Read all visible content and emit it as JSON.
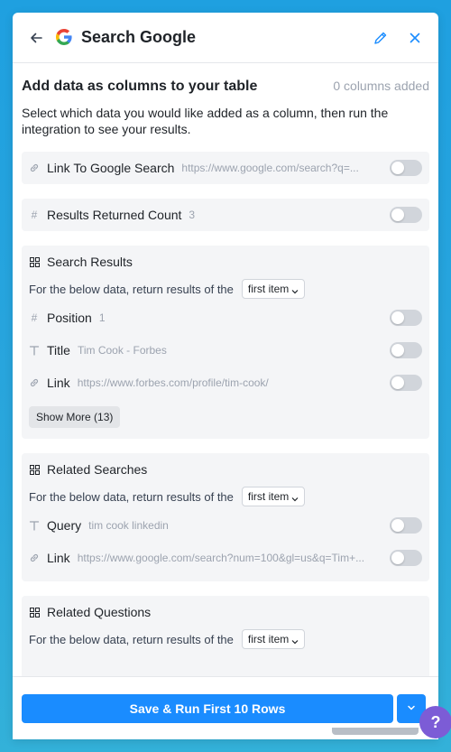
{
  "header": {
    "title": "Search Google"
  },
  "intro": {
    "heading": "Add data as columns to your table",
    "columns_added": "0 columns added",
    "description": "Select which data you would like added as a column, then run the integration to see your results."
  },
  "fields": [
    {
      "icon": "link-icon",
      "label": "Link To Google Search",
      "sample": "https://www.google.com/search?q=..."
    },
    {
      "icon": "hash-icon",
      "label": "Results Returned Count",
      "sample": "3"
    }
  ],
  "groups": [
    {
      "title": "Search Results",
      "return_text": "For the below data, return results of the",
      "dropdown": "first item",
      "items": [
        {
          "icon": "hash-icon",
          "label": "Position",
          "sample": "1"
        },
        {
          "icon": "text-icon",
          "label": "Title",
          "sample": "Tim Cook - Forbes"
        },
        {
          "icon": "link-icon",
          "label": "Link",
          "sample": "https://www.forbes.com/profile/tim-cook/"
        }
      ],
      "show_more": "Show More (13)"
    },
    {
      "title": "Related Searches",
      "return_text": "For the below data, return results of the",
      "dropdown": "first item",
      "items": [
        {
          "icon": "text-icon",
          "label": "Query",
          "sample": "tim cook linkedin"
        },
        {
          "icon": "link-icon",
          "label": "Link",
          "sample": "https://www.google.com/search?num=100&gl=us&q=Tim+..."
        }
      ]
    },
    {
      "title": "Related Questions",
      "return_text": "For the below data, return results of the",
      "dropdown": "first item"
    }
  ],
  "footer": {
    "primary_label": "Save & Run First 10 Rows"
  },
  "help": {
    "glyph": "?"
  },
  "colors": {
    "primary": "#1a8cff",
    "background": "#2aa6dc",
    "card": "#f4f5f7"
  }
}
